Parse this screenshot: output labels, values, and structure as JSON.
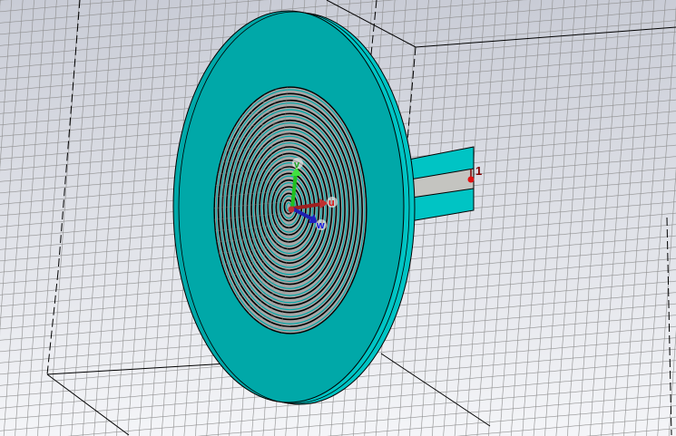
{
  "viewport": {
    "port_label": "1",
    "axes": {
      "u": "u",
      "v": "v",
      "w": "w"
    },
    "colors": {
      "background_top": "#c9ccd6",
      "background_bottom": "#f4f5f8",
      "grid": "#8c8c8c",
      "substrate": "#00a8a8",
      "substrate_rim": "#00c4c4",
      "metal": "#a6a6a6",
      "feed_line": "#c4c4c0",
      "u_axis": "#b02020",
      "v_axis": "#20c020",
      "w_axis": "#2020b0",
      "port": "#e01010"
    },
    "spiral_ring_count": 18
  }
}
